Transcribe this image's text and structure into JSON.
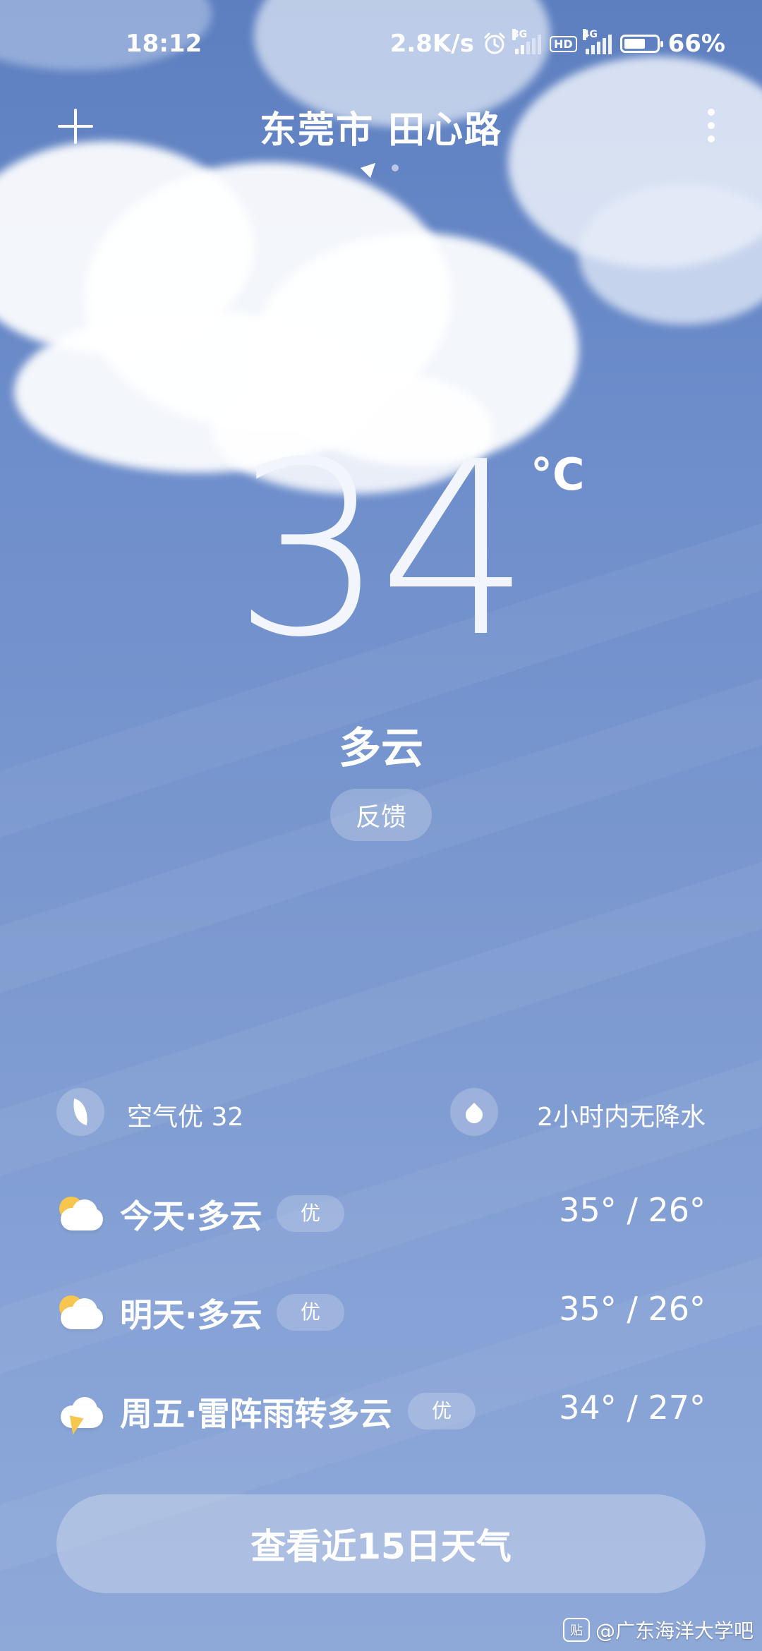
{
  "status_bar": {
    "time": "18:12",
    "net_speed": "2.8K/s",
    "sim1_type": "3G",
    "hd_label": "HD",
    "sim2_type": "4G",
    "battery_text": "66%",
    "battery_level": 0.66,
    "alarm_icon": "alarm-clock-icon"
  },
  "header": {
    "city": "东莞市 田心路",
    "add_icon": "plus-icon",
    "menu_icon": "more-vertical-icon",
    "location_icon": "location-arrow-icon",
    "page_count": 2,
    "active_page": 0
  },
  "current": {
    "temperature": "34",
    "unit": "°C",
    "condition": "多云",
    "feedback_label": "反馈"
  },
  "summary": {
    "air_quality": "空气优 32",
    "air_icon": "leaf-icon",
    "precipitation": "2小时内无降水",
    "precip_icon": "water-drop-icon"
  },
  "forecast": [
    {
      "label": "今天·多云",
      "badge": "优",
      "temp": "35° / 26°",
      "icon": "partly-cloudy-icon"
    },
    {
      "label": "明天·多云",
      "badge": "优",
      "temp": "35° / 26°",
      "icon": "partly-cloudy-icon"
    },
    {
      "label": "周五·雷阵雨转多云",
      "badge": "优",
      "temp": "34° / 27°",
      "icon": "thunderstorm-icon"
    }
  ],
  "footer": {
    "more_days_label": "查看近15日天气",
    "watermark": "@广东海洋大学吧",
    "watermark_logo": "贴"
  },
  "colors": {
    "sky_top": "#5d7fc0",
    "sky_bottom": "#8ea8d8",
    "sun": "#f6c64f"
  }
}
